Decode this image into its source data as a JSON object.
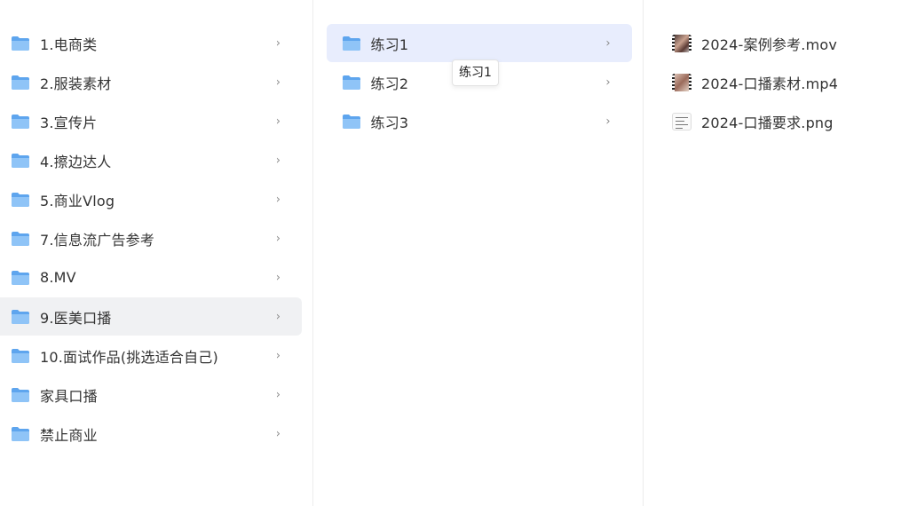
{
  "column1": {
    "items": [
      {
        "label": "1.电商类"
      },
      {
        "label": "2.服装素材"
      },
      {
        "label": "3.宣传片"
      },
      {
        "label": "4.擦边达人"
      },
      {
        "label": "5.商业Vlog"
      },
      {
        "label": "7.信息流广告参考"
      },
      {
        "label": "8.MV"
      },
      {
        "label": "9.医美口播"
      },
      {
        "label": "10.面试作品(挑选适合自己)"
      },
      {
        "label": "家具口播"
      },
      {
        "label": "禁止商业"
      }
    ],
    "hovered_item": "9.医美口播"
  },
  "column2": {
    "items": [
      {
        "label": "练习1"
      },
      {
        "label": "练习2"
      },
      {
        "label": "练习3"
      }
    ],
    "selected_item": "练习1"
  },
  "column3": {
    "files": [
      {
        "label": "2024-案例参考.mov",
        "icon": "video-thumbnail-icon"
      },
      {
        "label": "2024-口播素材.mp4",
        "icon": "video-thumbnail-icon"
      },
      {
        "label": "2024-口播要求.png",
        "icon": "image-thumbnail-icon"
      }
    ]
  },
  "tooltip": {
    "text": "练习1"
  },
  "chevron_glyph": "›",
  "colors": {
    "folder": "#6aaef0",
    "selected_bg": "#e8edfd",
    "hover_bg": "#f0f1f3"
  }
}
